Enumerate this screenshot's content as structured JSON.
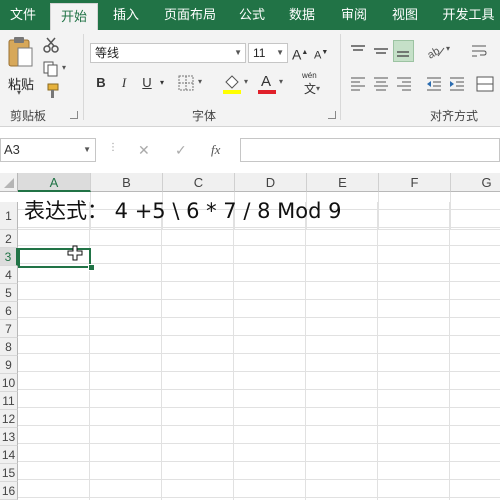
{
  "ribbon_tabs": [
    "文件",
    "开始",
    "插入",
    "页面布局",
    "公式",
    "数据",
    "审阅",
    "视图",
    "开发工具"
  ],
  "active_tab": "开始",
  "clipboard": {
    "paste_label": "粘贴",
    "group_label": "剪贴板"
  },
  "font": {
    "name": "等线",
    "size": "11",
    "grow": "A",
    "shrink": "A",
    "bold": "B",
    "italic": "I",
    "underline": "U",
    "phonetic": "wén",
    "phonetic_char": "文",
    "font_color_letter": "A",
    "group_label": "字体"
  },
  "alignment": {
    "group_label": "对齐方式"
  },
  "formula_bar": {
    "name_box": "A3",
    "fx": "fx",
    "cancel": "✕",
    "enter": "✓",
    "content": ""
  },
  "columns": [
    "A",
    "B",
    "C",
    "D",
    "E",
    "F",
    "G"
  ],
  "selected_column": "A",
  "rows": [
    "1",
    "2",
    "3",
    "4",
    "5",
    "6",
    "7",
    "8",
    "9",
    "10",
    "11",
    "12",
    "13",
    "14",
    "15",
    "16"
  ],
  "selected_row": "3",
  "cells": {
    "A1": "表达式： 4 +5 \\ 6 * 7 / 8 Mod 9"
  },
  "colors": {
    "accent": "#217346",
    "ribbon_bg": "#f3f3f3",
    "font_color_bar": "#e0202a",
    "fill_color_bar": "#ffff00"
  }
}
